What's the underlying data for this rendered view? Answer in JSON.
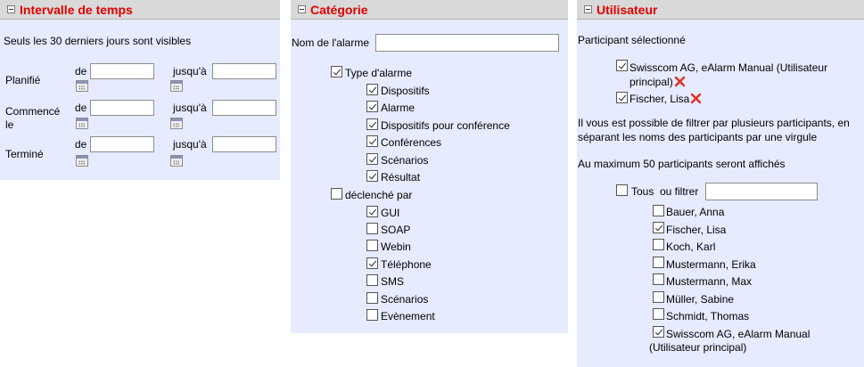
{
  "time": {
    "title": "Intervalle de temps",
    "note": "Seuls les 30 derniers jours sont visibles",
    "rows": [
      {
        "label": "Planifié",
        "from": "de",
        "to": "jusqu'à",
        "from_value": "",
        "to_value": ""
      },
      {
        "label_line1": "Commencé",
        "label_line2": "le",
        "from": "de",
        "to": "jusqu'à",
        "from_value": "",
        "to_value": ""
      },
      {
        "label": "Terminé",
        "from": "de",
        "to": "jusqu'à",
        "from_value": "",
        "to_value": ""
      }
    ]
  },
  "category": {
    "title": "Catégorie",
    "name_label": "Nom de l'alarme",
    "name_value": "",
    "type_group": {
      "label": "Type d'alarme",
      "checked": true,
      "items": [
        {
          "label": "Dispositifs",
          "checked": true
        },
        {
          "label": "Alarme",
          "checked": true
        },
        {
          "label": "Dispositifs pour conférence",
          "checked": true
        },
        {
          "label": "Conférences",
          "checked": true
        },
        {
          "label": "Scénarios",
          "checked": true
        },
        {
          "label": "Résultat",
          "checked": true
        }
      ]
    },
    "trigger_group": {
      "label": "déclenché par",
      "checked": false,
      "items": [
        {
          "label": "GUI",
          "checked": true
        },
        {
          "label": "SOAP",
          "checked": false
        },
        {
          "label": "Webin",
          "checked": false
        },
        {
          "label": "Téléphone",
          "checked": true
        },
        {
          "label": "SMS",
          "checked": false
        },
        {
          "label": "Scénarios",
          "checked": false
        },
        {
          "label": "Evènement",
          "checked": false
        }
      ]
    }
  },
  "user": {
    "title": "Utilisateur",
    "selected_label": "Participant sélectionné",
    "selected": [
      {
        "line1": "Swisscom AG, eAlarm Manual (Utilisateur",
        "line2": "principal)",
        "checked": true
      },
      {
        "line1": "Fischer, Lisa",
        "checked": true
      }
    ],
    "help_line1": "Il vous est possible de filtrer par plusieurs participants, en",
    "help_line2": "séparant les noms des participants par une virgule",
    "max_note": "Au maximum 50 participants seront affichés",
    "all_label": "Tous",
    "filter_label": "ou filtrer",
    "filter_value": "",
    "participants": [
      {
        "label": "Bauer, Anna",
        "checked": false
      },
      {
        "label": "Fischer, Lisa",
        "checked": true
      },
      {
        "label": "Koch, Karl",
        "checked": false
      },
      {
        "label": "Mustermann, Erika",
        "checked": false
      },
      {
        "label": "Mustermann, Max",
        "checked": false
      },
      {
        "label": "Müller, Sabine",
        "checked": false
      },
      {
        "label": "Schmidt, Thomas",
        "checked": false
      },
      {
        "line1": "Swisscom AG, eAlarm Manual",
        "line2": "(Utilisateur principal)",
        "checked": true
      }
    ],
    "colors": {
      "title": "#e00000",
      "remove": "#e03020",
      "panel": "#e6ebff"
    }
  }
}
